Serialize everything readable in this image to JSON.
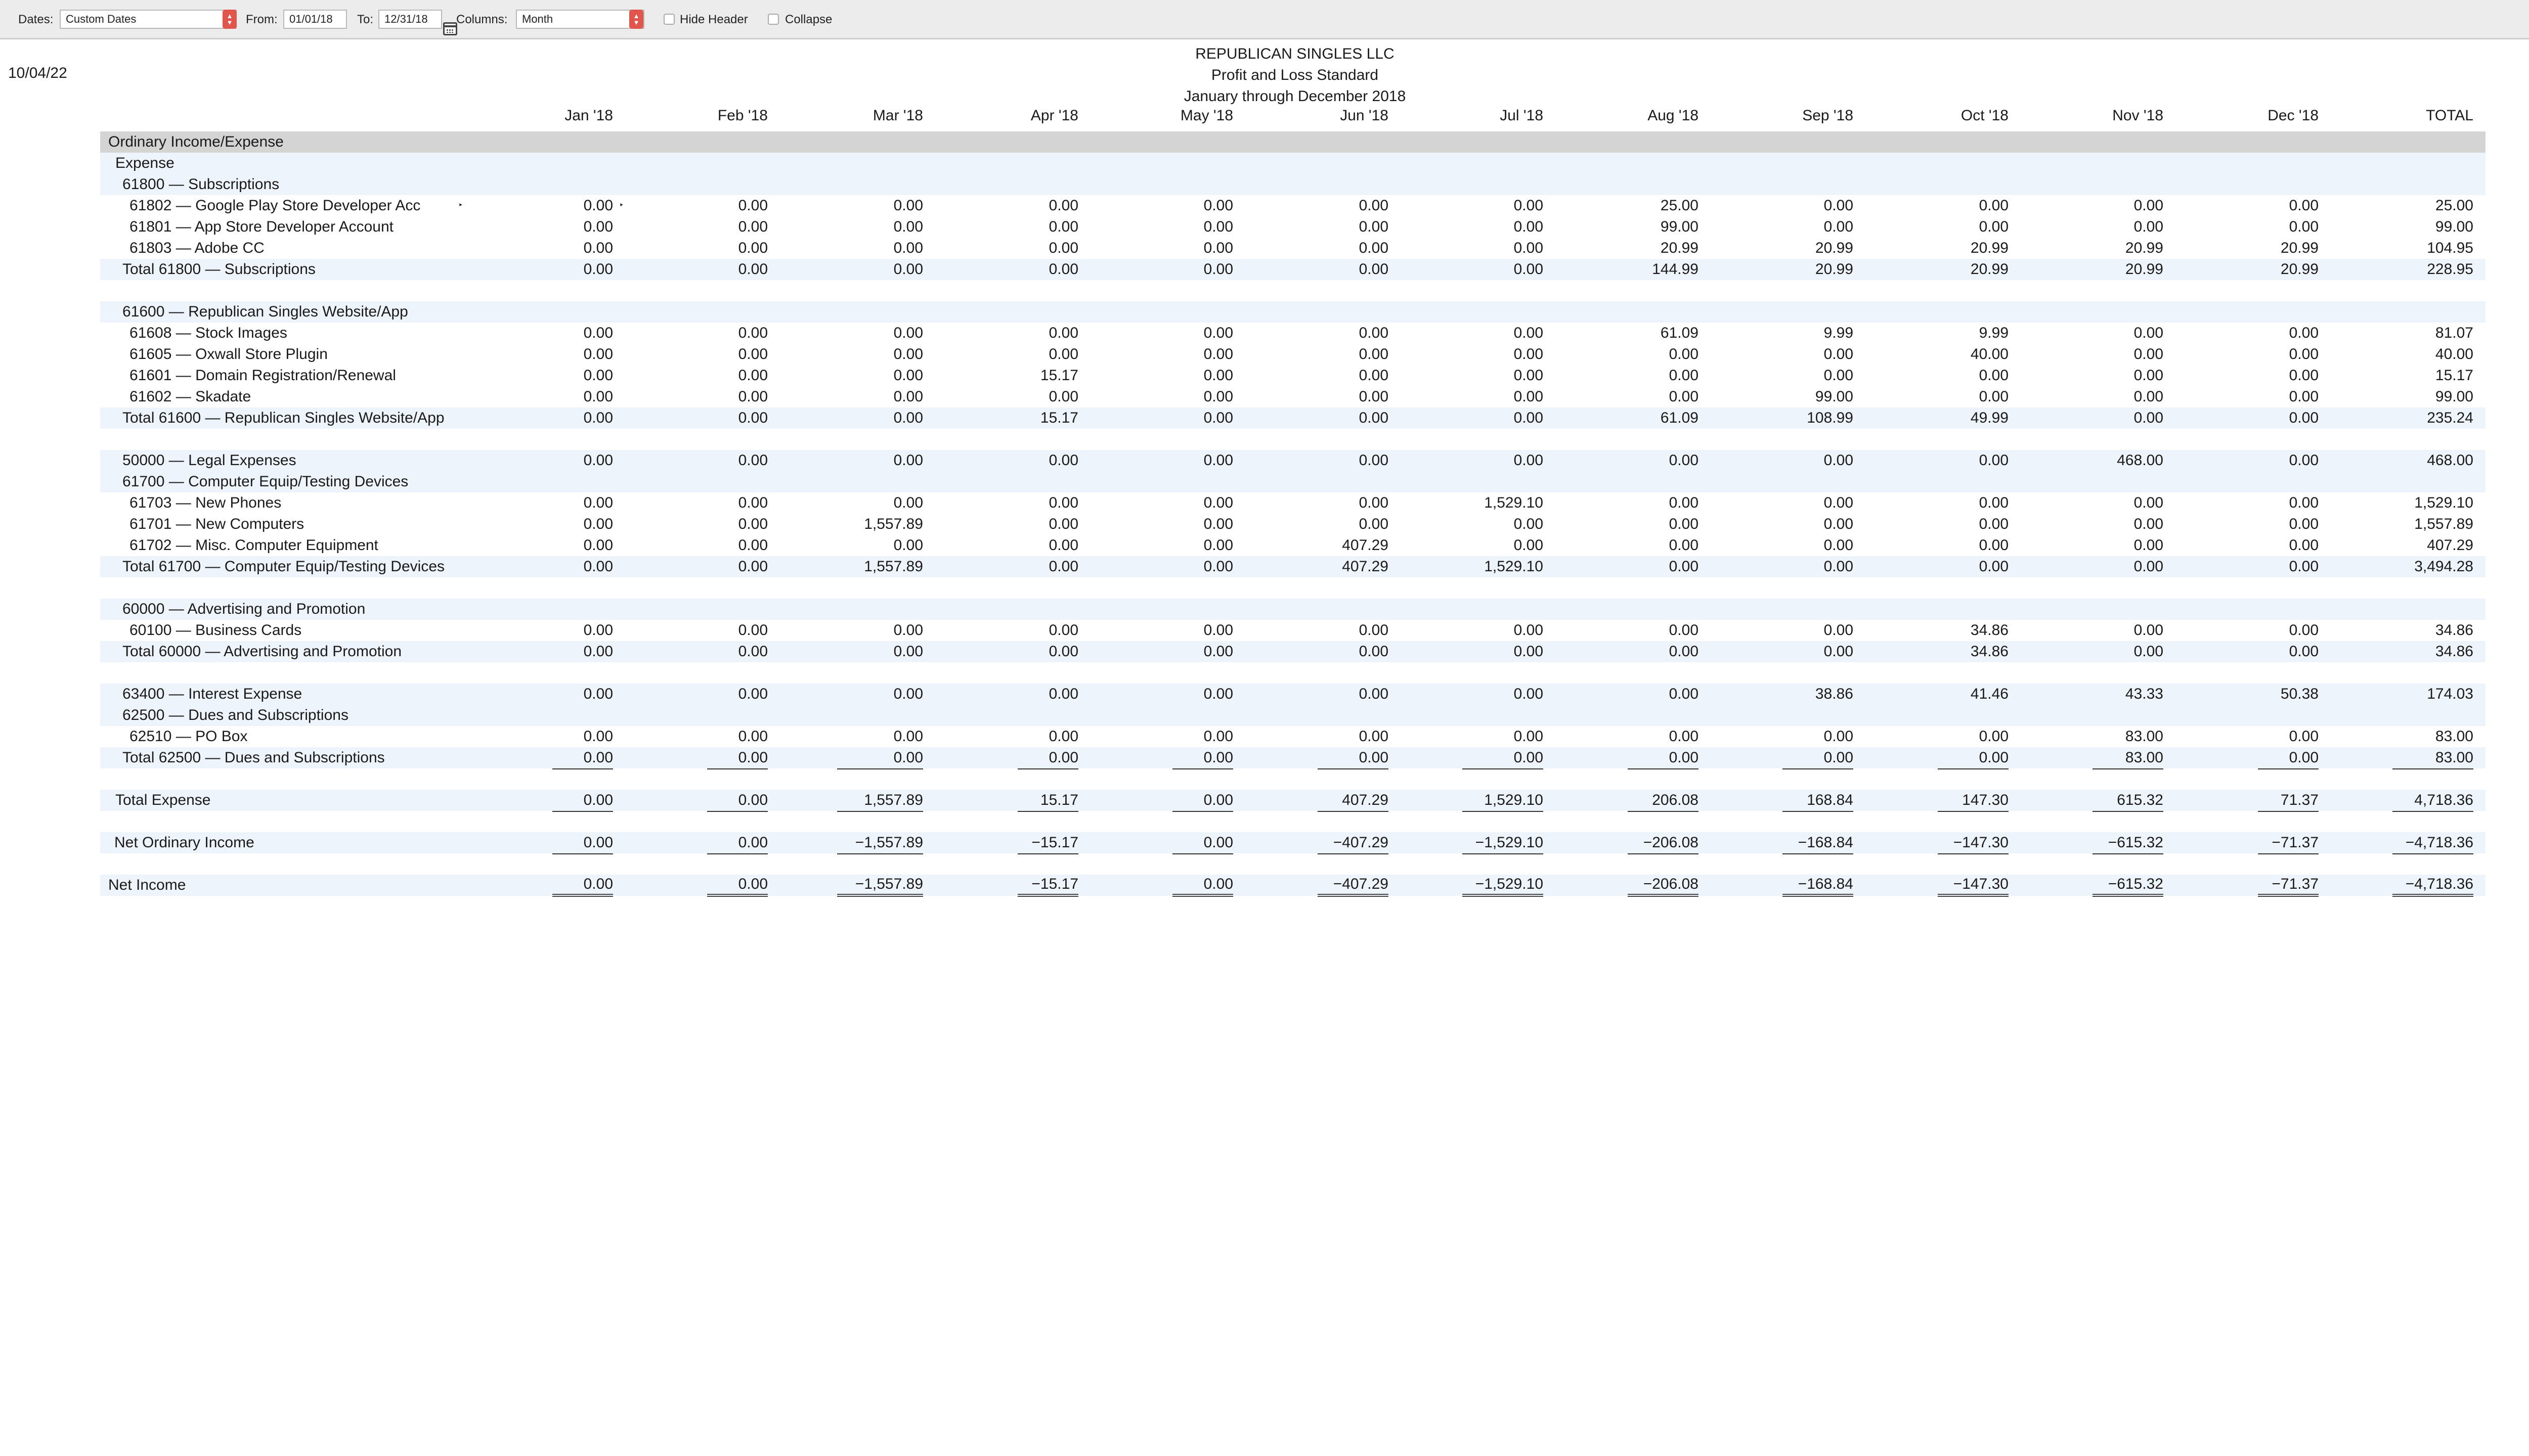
{
  "toolbar": {
    "dates_label": "Dates:",
    "dates_value": "Custom Dates",
    "from_label": "From:",
    "from_value": "01/01/18",
    "to_label": "To:",
    "to_value": "12/31/18",
    "columns_label": "Columns:",
    "columns_value": "Month",
    "hide_header_label": "Hide Header",
    "collapse_label": "Collapse"
  },
  "report": {
    "printed_date": "10/04/22",
    "company": "REPUBLICAN SINGLES LLC",
    "title": "Profit and Loss Standard",
    "period": "January through December 2018",
    "columns": [
      "Jan '18",
      "Feb '18",
      "Mar '18",
      "Apr '18",
      "May '18",
      "Jun '18",
      "Jul '18",
      "Aug '18",
      "Sep '18",
      "Oct '18",
      "Nov '18",
      "Dec '18",
      "TOTAL"
    ],
    "rows": [
      {
        "label": "Ordinary Income/Expense",
        "indent": 0,
        "style": "header"
      },
      {
        "label": "Expense",
        "indent": 1,
        "style": "band"
      },
      {
        "label": "61800 — Subscriptions",
        "indent": 2,
        "style": "band"
      },
      {
        "label": "61802 — Google Play Store Developer Acc",
        "indent": 3,
        "values": [
          "0.00",
          "0.00",
          "0.00",
          "0.00",
          "0.00",
          "0.00",
          "0.00",
          "25.00",
          "0.00",
          "0.00",
          "0.00",
          "0.00",
          "25.00"
        ]
      },
      {
        "label": "61801 — App Store Developer Account",
        "indent": 3,
        "values": [
          "0.00",
          "0.00",
          "0.00",
          "0.00",
          "0.00",
          "0.00",
          "0.00",
          "99.00",
          "0.00",
          "0.00",
          "0.00",
          "0.00",
          "99.00"
        ]
      },
      {
        "label": "61803 — Adobe CC",
        "indent": 3,
        "values": [
          "0.00",
          "0.00",
          "0.00",
          "0.00",
          "0.00",
          "0.00",
          "0.00",
          "20.99",
          "20.99",
          "20.99",
          "20.99",
          "20.99",
          "104.95"
        ],
        "underline": true
      },
      {
        "label": "Total 61800 — Subscriptions",
        "indent": 2,
        "style": "band",
        "values": [
          "0.00",
          "0.00",
          "0.00",
          "0.00",
          "0.00",
          "0.00",
          "0.00",
          "144.99",
          "20.99",
          "20.99",
          "20.99",
          "20.99",
          "228.95"
        ]
      },
      {
        "label": "",
        "indent": 0
      },
      {
        "label": "61600 — Republican Singles Website/App",
        "indent": 2,
        "style": "band"
      },
      {
        "label": "61608 — Stock Images",
        "indent": 3,
        "values": [
          "0.00",
          "0.00",
          "0.00",
          "0.00",
          "0.00",
          "0.00",
          "0.00",
          "61.09",
          "9.99",
          "9.99",
          "0.00",
          "0.00",
          "81.07"
        ]
      },
      {
        "label": "61605 — Oxwall Store Plugin",
        "indent": 3,
        "values": [
          "0.00",
          "0.00",
          "0.00",
          "0.00",
          "0.00",
          "0.00",
          "0.00",
          "0.00",
          "0.00",
          "40.00",
          "0.00",
          "0.00",
          "40.00"
        ]
      },
      {
        "label": "61601 — Domain Registration/Renewal",
        "indent": 3,
        "values": [
          "0.00",
          "0.00",
          "0.00",
          "15.17",
          "0.00",
          "0.00",
          "0.00",
          "0.00",
          "0.00",
          "0.00",
          "0.00",
          "0.00",
          "15.17"
        ]
      },
      {
        "label": "61602 — Skadate",
        "indent": 3,
        "values": [
          "0.00",
          "0.00",
          "0.00",
          "0.00",
          "0.00",
          "0.00",
          "0.00",
          "0.00",
          "99.00",
          "0.00",
          "0.00",
          "0.00",
          "99.00"
        ],
        "underline": true
      },
      {
        "label": "Total 61600 — Republican Singles Website/App",
        "indent": 2,
        "style": "band",
        "values": [
          "0.00",
          "0.00",
          "0.00",
          "15.17",
          "0.00",
          "0.00",
          "0.00",
          "61.09",
          "108.99",
          "49.99",
          "0.00",
          "0.00",
          "235.24"
        ]
      },
      {
        "label": "",
        "indent": 0
      },
      {
        "label": "50000 — Legal Expenses",
        "indent": 2,
        "style": "band",
        "values": [
          "0.00",
          "0.00",
          "0.00",
          "0.00",
          "0.00",
          "0.00",
          "0.00",
          "0.00",
          "0.00",
          "0.00",
          "468.00",
          "0.00",
          "468.00"
        ]
      },
      {
        "label": "61700 — Computer Equip/Testing Devices",
        "indent": 2,
        "style": "band"
      },
      {
        "label": "61703 — New Phones",
        "indent": 3,
        "values": [
          "0.00",
          "0.00",
          "0.00",
          "0.00",
          "0.00",
          "0.00",
          "1,529.10",
          "0.00",
          "0.00",
          "0.00",
          "0.00",
          "0.00",
          "1,529.10"
        ]
      },
      {
        "label": "61701 — New Computers",
        "indent": 3,
        "values": [
          "0.00",
          "0.00",
          "1,557.89",
          "0.00",
          "0.00",
          "0.00",
          "0.00",
          "0.00",
          "0.00",
          "0.00",
          "0.00",
          "0.00",
          "1,557.89"
        ]
      },
      {
        "label": "61702 — Misc. Computer Equipment",
        "indent": 3,
        "values": [
          "0.00",
          "0.00",
          "0.00",
          "0.00",
          "0.00",
          "407.29",
          "0.00",
          "0.00",
          "0.00",
          "0.00",
          "0.00",
          "0.00",
          "407.29"
        ],
        "underline": true
      },
      {
        "label": "Total 61700 — Computer Equip/Testing Devices",
        "indent": 2,
        "style": "band",
        "values": [
          "0.00",
          "0.00",
          "1,557.89",
          "0.00",
          "0.00",
          "407.29",
          "1,529.10",
          "0.00",
          "0.00",
          "0.00",
          "0.00",
          "0.00",
          "3,494.28"
        ]
      },
      {
        "label": "",
        "indent": 0
      },
      {
        "label": "60000 — Advertising and Promotion",
        "indent": 2,
        "style": "band"
      },
      {
        "label": "60100 — Business Cards",
        "indent": 3,
        "values": [
          "0.00",
          "0.00",
          "0.00",
          "0.00",
          "0.00",
          "0.00",
          "0.00",
          "0.00",
          "0.00",
          "34.86",
          "0.00",
          "0.00",
          "34.86"
        ],
        "underline": true
      },
      {
        "label": "Total 60000 — Advertising and Promotion",
        "indent": 2,
        "style": "band",
        "values": [
          "0.00",
          "0.00",
          "0.00",
          "0.00",
          "0.00",
          "0.00",
          "0.00",
          "0.00",
          "0.00",
          "34.86",
          "0.00",
          "0.00",
          "34.86"
        ]
      },
      {
        "label": "",
        "indent": 0
      },
      {
        "label": "63400 — Interest Expense",
        "indent": 2,
        "style": "band",
        "values": [
          "0.00",
          "0.00",
          "0.00",
          "0.00",
          "0.00",
          "0.00",
          "0.00",
          "0.00",
          "38.86",
          "41.46",
          "43.33",
          "50.38",
          "174.03"
        ]
      },
      {
        "label": "62500 — Dues and Subscriptions",
        "indent": 2,
        "style": "band"
      },
      {
        "label": "62510 — PO Box",
        "indent": 3,
        "values": [
          "0.00",
          "0.00",
          "0.00",
          "0.00",
          "0.00",
          "0.00",
          "0.00",
          "0.00",
          "0.00",
          "0.00",
          "83.00",
          "0.00",
          "83.00"
        ],
        "underline": true
      },
      {
        "label": "Total 62500 — Dues and Subscriptions",
        "indent": 2,
        "style": "band",
        "values": [
          "0.00",
          "0.00",
          "0.00",
          "0.00",
          "0.00",
          "0.00",
          "0.00",
          "0.00",
          "0.00",
          "0.00",
          "83.00",
          "0.00",
          "83.00"
        ],
        "underline": true
      },
      {
        "label": "",
        "indent": 0
      },
      {
        "label": "Total Expense",
        "indent": 1,
        "style": "band",
        "values": [
          "0.00",
          "0.00",
          "1,557.89",
          "15.17",
          "0.00",
          "407.29",
          "1,529.10",
          "206.08",
          "168.84",
          "147.30",
          "615.32",
          "71.37",
          "4,718.36"
        ],
        "underline": true
      },
      {
        "label": "",
        "indent": 0
      },
      {
        "label": "Net Ordinary Income",
        "indent": 0.5,
        "style": "band",
        "values": [
          "0.00",
          "0.00",
          "−1,557.89",
          "−15.17",
          "0.00",
          "−407.29",
          "−1,529.10",
          "−206.08",
          "−168.84",
          "−147.30",
          "−615.32",
          "−71.37",
          "−4,718.36"
        ],
        "underline": true
      },
      {
        "label": "",
        "indent": 0
      },
      {
        "label": "Net Income",
        "indent": 0,
        "style": "band",
        "values": [
          "0.00",
          "0.00",
          "−1,557.89",
          "−15.17",
          "0.00",
          "−407.29",
          "−1,529.10",
          "−206.08",
          "−168.84",
          "−147.30",
          "−615.32",
          "−71.37",
          "−4,718.36"
        ],
        "double": true
      }
    ]
  }
}
